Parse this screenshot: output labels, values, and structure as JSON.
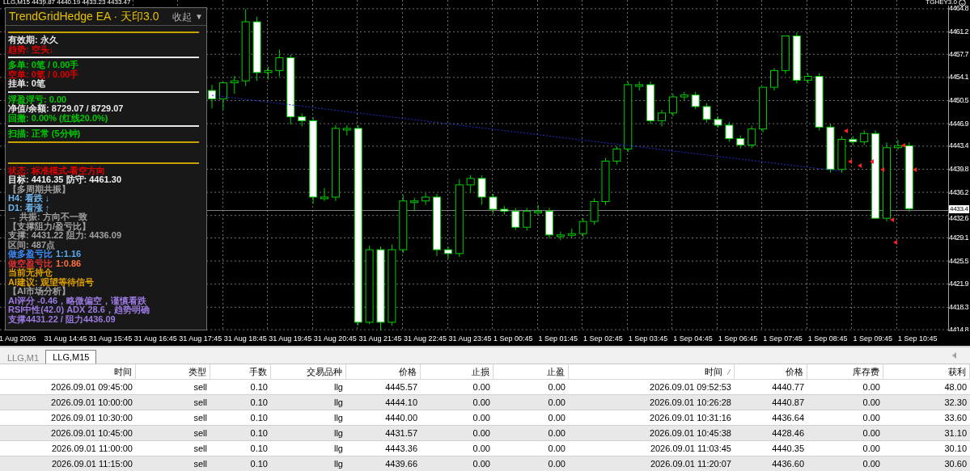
{
  "chart": {
    "header": "LLG,M15  4439.87 4440.19 4433.23 4433.47",
    "indicator_label": "TGHEY3.0",
    "price_axis": [
      "4464.8",
      "4461.2",
      "4457.7",
      "4454.1",
      "4450.5",
      "4446.9",
      "4443.4",
      "4439.8",
      "4436.2",
      "4432.6",
      "4429.1",
      "4425.5",
      "4421.9",
      "4418.3",
      "4414.8"
    ],
    "current_price": "4433.4",
    "chart_data": {
      "type": "candlestick",
      "ylim": [
        4414.5,
        4466.1
      ],
      "grid": true,
      "ref_lines": [
        {
          "axis": "y",
          "value": 4433.4
        }
      ],
      "yticks": [
        4464.8,
        4461.2,
        4457.7,
        4454.1,
        4450.5,
        4446.9,
        4443.4,
        4439.8,
        4436.2,
        4432.6,
        4429.1,
        4425.5,
        4421.9,
        4418.3,
        4414.8
      ],
      "ohlc": [
        [
          4452.0,
          4452.9,
          4449.2,
          4450.7
        ],
        [
          4450.7,
          4453.2,
          4449.0,
          4453.2
        ],
        [
          4453.2,
          4454.3,
          4451.5,
          4453.5
        ],
        [
          4453.5,
          4464.7,
          4452.7,
          4462.7
        ],
        [
          4462.7,
          4463.5,
          4453.5,
          4454.8
        ],
        [
          4454.8,
          4455.7,
          4453.7,
          4455.1
        ],
        [
          4455.1,
          4458.4,
          4454.2,
          4457.1
        ],
        [
          4457.1,
          4457.6,
          4446.7,
          4447.9
        ],
        [
          4447.9,
          4448.4,
          4446.4,
          4447.3
        ],
        [
          4447.3,
          4447.8,
          4434.4,
          4435.4
        ],
        [
          4435.4,
          4436.8,
          4434.8,
          4435.4
        ],
        [
          4435.4,
          4446.6,
          4434.8,
          4446.1
        ],
        [
          4446.1,
          4446.6,
          4445.0,
          4446.1
        ],
        [
          4446.1,
          4446.6,
          4415.4,
          4415.9
        ],
        [
          4415.9,
          4427.8,
          4415.6,
          4427.2
        ],
        [
          4427.2,
          4427.7,
          4414.6,
          4415.9
        ],
        [
          4415.9,
          4428.0,
          4415.4,
          4427.2
        ],
        [
          4427.2,
          4435.7,
          4426.7,
          4434.8
        ],
        [
          4434.8,
          4435.3,
          4433.2,
          4434.8
        ],
        [
          4434.8,
          4436.0,
          4434.2,
          4435.4
        ],
        [
          4435.4,
          4435.9,
          4426.2,
          4427.2
        ],
        [
          4427.2,
          4427.7,
          4425.8,
          4426.6
        ],
        [
          4426.6,
          4438.2,
          4426.1,
          4437.3
        ],
        [
          4437.3,
          4438.8,
          4436.1,
          4438.3
        ],
        [
          4438.3,
          4438.8,
          4434.2,
          4435.4
        ],
        [
          4435.4,
          4435.9,
          4432.8,
          4433.5
        ],
        [
          4433.5,
          4434.0,
          4432.7,
          4433.2
        ],
        [
          4433.2,
          4433.7,
          4430.3,
          4430.7
        ],
        [
          4430.7,
          4433.7,
          4430.2,
          4433.2
        ],
        [
          4433.2,
          4434.2,
          4432.7,
          4433.2
        ],
        [
          4433.2,
          4433.7,
          4429.0,
          4429.5
        ],
        [
          4429.5,
          4430.0,
          4428.7,
          4429.5
        ],
        [
          4429.5,
          4430.5,
          4429.0,
          4429.7
        ],
        [
          4429.7,
          4432.1,
          4429.2,
          4431.6
        ],
        [
          4431.6,
          4435.2,
          4431.1,
          4434.7
        ],
        [
          4434.7,
          4441.5,
          4434.2,
          4441.0
        ],
        [
          4441.0,
          4443.3,
          4440.5,
          4442.9
        ],
        [
          4442.9,
          4453.4,
          4442.4,
          4452.9
        ],
        [
          4452.9,
          4453.4,
          4452.0,
          4452.9
        ],
        [
          4452.9,
          4453.4,
          4446.8,
          4447.3
        ],
        [
          4447.3,
          4449.0,
          4446.4,
          4448.5
        ],
        [
          4448.5,
          4451.5,
          4448.0,
          4451.0
        ],
        [
          4451.0,
          4451.8,
          4450.5,
          4451.3
        ],
        [
          4451.3,
          4451.8,
          4449.1,
          4449.5
        ],
        [
          4449.5,
          4450.0,
          4447.0,
          4447.5
        ],
        [
          4447.5,
          4448.0,
          4446.2,
          4446.6
        ],
        [
          4446.6,
          4447.1,
          4444.0,
          4444.5
        ],
        [
          4444.5,
          4445.0,
          4443.0,
          4443.5
        ],
        [
          4443.5,
          4446.5,
          4443.0,
          4446.0
        ],
        [
          4446.0,
          4452.5,
          4445.5,
          4452.5
        ],
        [
          4452.5,
          4455.5,
          4452.0,
          4455.1
        ],
        [
          4455.1,
          4460.5,
          4454.6,
          4460.5
        ],
        [
          4460.5,
          4461.0,
          4453.1,
          4453.6
        ],
        [
          4453.6,
          4454.7,
          4453.1,
          4454.2
        ],
        [
          4454.2,
          4454.7,
          4445.8,
          4446.3
        ],
        [
          4446.3,
          4446.8,
          4439.2,
          4439.7
        ],
        [
          4439.7,
          4444.9,
          4439.2,
          4444.4
        ],
        [
          4444.4,
          4444.9,
          4443.5,
          4444.0
        ],
        [
          4444.0,
          4445.8,
          4443.5,
          4445.3
        ],
        [
          4445.3,
          4445.8,
          4432.1,
          4432.1
        ],
        [
          4432.1,
          4443.9,
          4431.6,
          4443.1
        ],
        [
          4443.1,
          4444.3,
          4442.8,
          4443.4
        ],
        [
          4443.4,
          4443.9,
          4433.1,
          4433.6
        ]
      ]
    },
    "time_axis": [
      "1 Aug 2026",
      "31 Aug 14:45",
      "31 Aug 15:45",
      "31 Aug 16:45",
      "31 Aug 17:45",
      "31 Aug 18:45",
      "31 Aug 19:45",
      "31 Aug 20:45",
      "31 Aug 21:45",
      "31 Aug 22:45",
      "31 Aug 23:45",
      "1 Sep 00:45",
      "1 Sep 01:45",
      "1 Sep 02:45",
      "1 Sep 03:45",
      "1 Sep 04:45",
      "1 Sep 06:45",
      "1 Sep 07:45",
      "1 Sep 08:45",
      "1 Sep 09:45",
      "1 Sep 10:45"
    ]
  },
  "panel": {
    "title": "TrendGridHedge EA · 天印3.0",
    "collapse_label": "收起",
    "collapse_icon": "▼",
    "rows": [
      {
        "kind": "rule",
        "color": "#c8a000"
      },
      {
        "kind": "text",
        "text": "有效期: 永久",
        "color": "#e8e8e8"
      },
      {
        "kind": "text",
        "text": "趋势: 空头↓",
        "color": "#e00000"
      },
      {
        "kind": "rule",
        "color": "#e8e8e8"
      },
      {
        "kind": "text",
        "text": "多单: 0笔 / 0.00手",
        "color": "#00c800"
      },
      {
        "kind": "text",
        "text": "空单: 0笔 / 0.00手",
        "color": "#e00000"
      },
      {
        "kind": "text",
        "text": "挂单: 0笔",
        "color": "#e8e8e8"
      },
      {
        "kind": "rule",
        "color": "#e8e8e8"
      },
      {
        "kind": "text",
        "text": "浮盈浮亏: 0.00",
        "color": "#00c800"
      },
      {
        "kind": "text",
        "text": "净值/余额: 8729.07 / 8729.07",
        "color": "#e8e8e8"
      },
      {
        "kind": "text",
        "text": "回撤: 0.00% (红线20.0%)",
        "color": "#00c800"
      },
      {
        "kind": "rule",
        "color": "#e8e8e8"
      },
      {
        "kind": "text",
        "text": "扫描: 正常 (5分钟)",
        "color": "#00c800"
      },
      {
        "kind": "rule",
        "color": "#c8a000"
      },
      {
        "kind": "gap"
      },
      {
        "kind": "rule",
        "color": "#c8a000"
      },
      {
        "kind": "text",
        "text": "状态: 标准模式-看空方向",
        "color": "#e00000"
      },
      {
        "kind": "text",
        "text": "目标: 4416.35  防守: 4461.30",
        "color": "#f0f0f0"
      },
      {
        "kind": "text",
        "text": "【多周期共振】",
        "color": "#a0a0a0"
      },
      {
        "kind": "text",
        "text": "H4: 看跌 ↓",
        "color": "#6fb4e8"
      },
      {
        "kind": "text",
        "text": "D1: 看涨 ↑",
        "color": "#6fb4e8"
      },
      {
        "kind": "text",
        "text": "→ 共振: 方向不一致",
        "color": "#a0a0a0"
      },
      {
        "kind": "text",
        "text": "【支撑阻力/盈亏比】",
        "color": "#a0a0a0"
      },
      {
        "kind": "text",
        "text": "支撑: 4431.22  阻力: 4436.09",
        "color": "#a0a0a0"
      },
      {
        "kind": "text",
        "text": "区间: 487点",
        "color": "#a0a0a0"
      },
      {
        "kind": "pair",
        "parts": [
          {
            "text": "做多盈亏比",
            "color": "#3c8cff"
          },
          {
            "text": "1:1.16",
            "color": "#5aaaf0"
          }
        ]
      },
      {
        "kind": "pair",
        "parts": [
          {
            "text": "做空盈亏比",
            "color": "#e03030"
          },
          {
            "text": "1:0.86",
            "color": "#ff7040"
          }
        ]
      },
      {
        "kind": "text",
        "text": "当前无持仓",
        "color": "#e0a000"
      },
      {
        "kind": "text",
        "text": "AI建议: 观望等待信号",
        "color": "#e0a000"
      },
      {
        "kind": "text",
        "text": "【AI市场分析】",
        "color": "#a0a0a0"
      },
      {
        "kind": "text",
        "text": "AI评分 -0.46，略微偏空，谨慎看跌",
        "color": "#9b7ae0"
      },
      {
        "kind": "text",
        "text": "RSI中性(42.0)  ADX 28.6，趋势明确",
        "color": "#9b7ae0"
      },
      {
        "kind": "text",
        "text": "支撑4431.22 / 阻力4436.09",
        "color": "#9b7ae0"
      }
    ]
  },
  "tabs": [
    {
      "label": "LLG,M1",
      "selected": false
    },
    {
      "label": "LLG,M15",
      "selected": true
    }
  ],
  "table": {
    "columns": [
      {
        "label": "时间"
      },
      {
        "label": "类型"
      },
      {
        "label": "手数"
      },
      {
        "label": "交易品种"
      },
      {
        "label": "价格"
      },
      {
        "label": "止损"
      },
      {
        "label": "止盈"
      },
      {
        "label": "时间",
        "sorted": true
      },
      {
        "label": "价格"
      },
      {
        "label": "库存费"
      },
      {
        "label": "获利"
      }
    ],
    "rows": [
      [
        "2026.09.01 09:45:00",
        "sell",
        "0.10",
        "llg",
        "4445.57",
        "0.00",
        "0.00",
        "2026.09.01 09:52:53",
        "4440.77",
        "0.00",
        "48.00"
      ],
      [
        "2026.09.01 10:00:00",
        "sell",
        "0.10",
        "llg",
        "4444.10",
        "0.00",
        "0.00",
        "2026.09.01 10:26:28",
        "4440.87",
        "0.00",
        "32.30"
      ],
      [
        "2026.09.01 10:30:00",
        "sell",
        "0.10",
        "llg",
        "4440.00",
        "0.00",
        "0.00",
        "2026.09.01 10:31:16",
        "4436.64",
        "0.00",
        "33.60"
      ],
      [
        "2026.09.01 10:45:00",
        "sell",
        "0.10",
        "llg",
        "4431.57",
        "0.00",
        "0.00",
        "2026.09.01 10:45:38",
        "4428.46",
        "0.00",
        "31.10"
      ],
      [
        "2026.09.01 11:00:00",
        "sell",
        "0.10",
        "llg",
        "4443.36",
        "0.00",
        "0.00",
        "2026.09.01 11:03:45",
        "4440.35",
        "0.00",
        "30.10"
      ],
      [
        "2026.09.01 11:15:00",
        "sell",
        "0.10",
        "llg",
        "4439.66",
        "0.00",
        "0.00",
        "2026.09.01 11:20:07",
        "4436.60",
        "0.00",
        "30.60"
      ]
    ]
  }
}
